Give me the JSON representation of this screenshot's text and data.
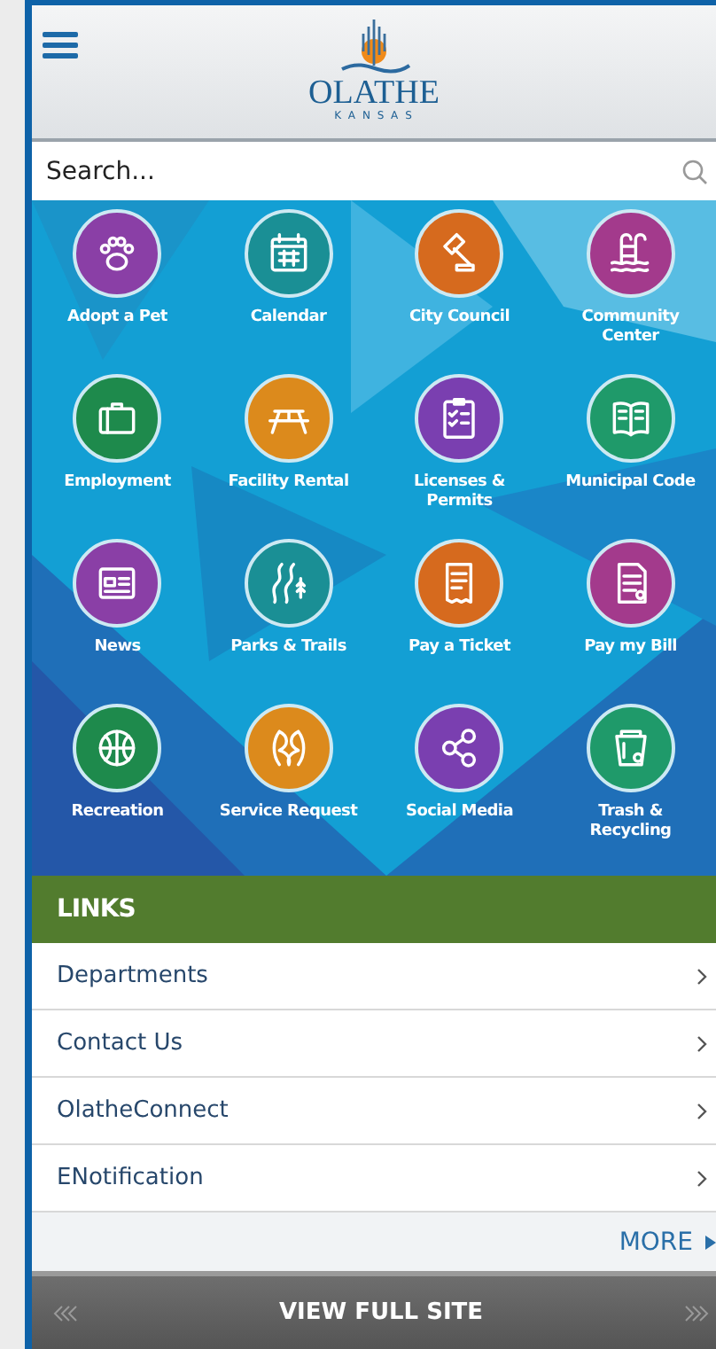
{
  "header": {
    "logo_name": "OLATHE",
    "logo_subtitle": "K A N S A S"
  },
  "search": {
    "placeholder": "Search..."
  },
  "tiles": [
    {
      "label": "Adopt a Pet",
      "color": "#8a3fa6"
    },
    {
      "label": "Calendar",
      "color": "#1a8f95"
    },
    {
      "label": "City Council",
      "color": "#d66a1e"
    },
    {
      "label": "Community Center",
      "color": "#a33a8c"
    },
    {
      "label": "Employment",
      "color": "#1e8a4c"
    },
    {
      "label": "Facility Rental",
      "color": "#dc8a1c"
    },
    {
      "label": "Licenses & Permits",
      "color": "#7a3fb0"
    },
    {
      "label": "Municipal Code",
      "color": "#1f9a6a"
    },
    {
      "label": "News",
      "color": "#8a3fa6"
    },
    {
      "label": "Parks & Trails",
      "color": "#1a8f95"
    },
    {
      "label": "Pay a Ticket",
      "color": "#d66a1e"
    },
    {
      "label": "Pay my Bill",
      "color": "#a33a8c"
    },
    {
      "label": "Recreation",
      "color": "#1e8a4c"
    },
    {
      "label": "Service Request",
      "color": "#dc8a1c"
    },
    {
      "label": "Social Media",
      "color": "#7a3fb0"
    },
    {
      "label": "Trash & Recycling",
      "color": "#1f9a6a"
    }
  ],
  "links": {
    "title": "LINKS",
    "items": [
      "Departments",
      "Contact Us",
      "OlatheConnect",
      "ENotification"
    ],
    "more": "MORE"
  },
  "footer": {
    "label": "VIEW FULL SITE"
  }
}
